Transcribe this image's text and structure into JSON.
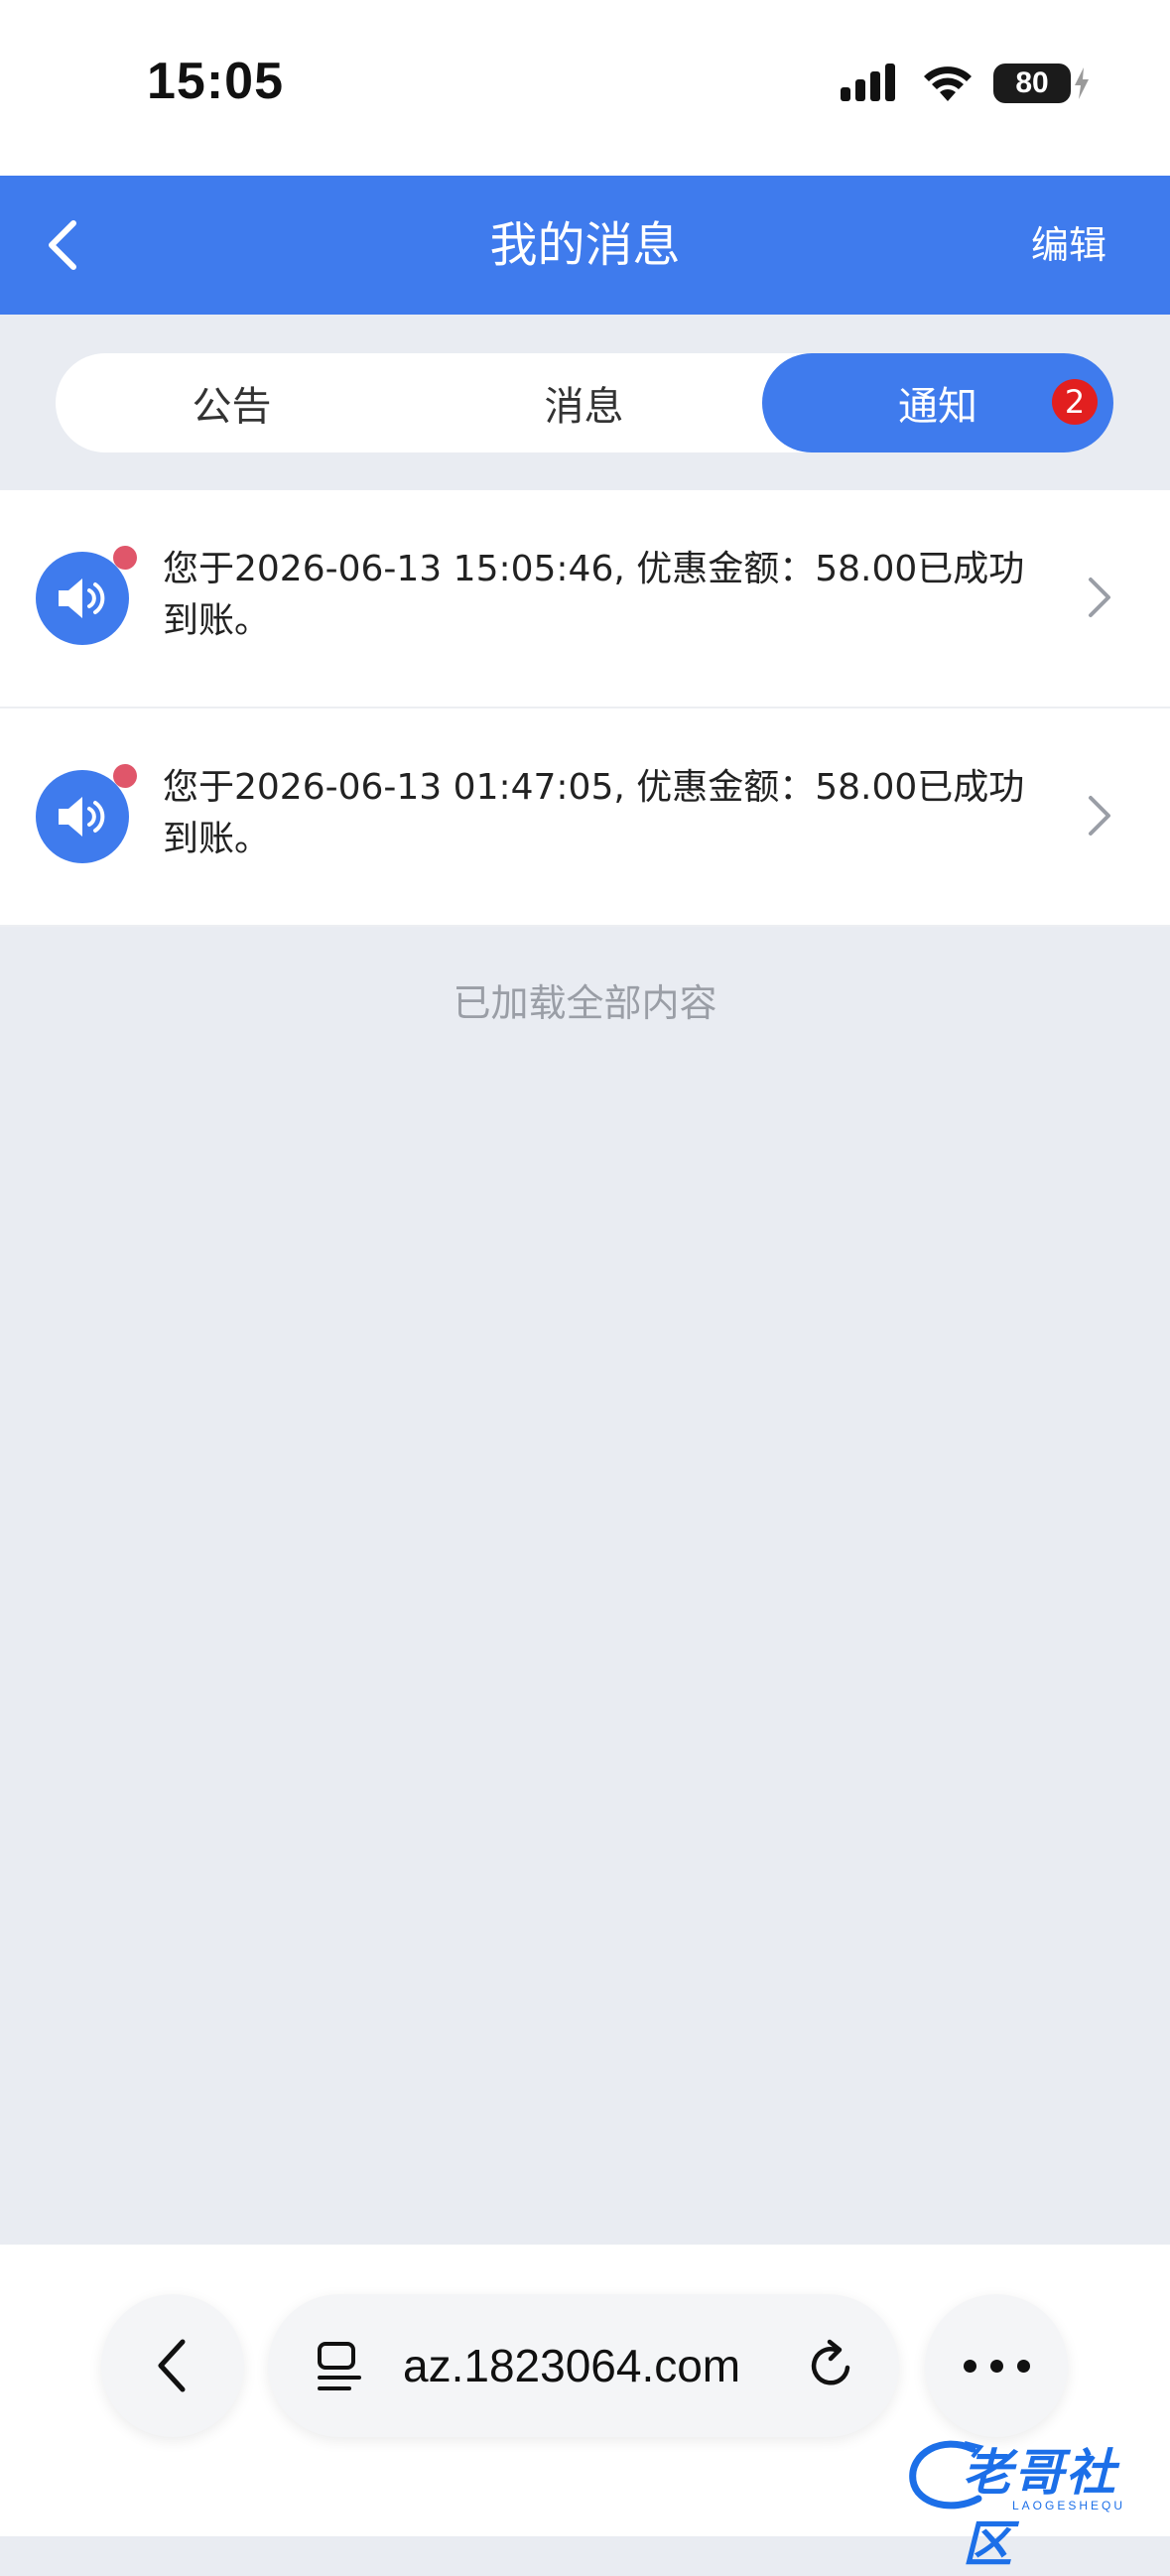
{
  "status_bar": {
    "time": "15:05",
    "battery": "80"
  },
  "header": {
    "title": "我的消息",
    "edit_label": "编辑"
  },
  "tabs": [
    {
      "label": "公告",
      "active": false
    },
    {
      "label": "消息",
      "active": false
    },
    {
      "label": "通知",
      "active": true,
      "badge": "2"
    }
  ],
  "notices": [
    {
      "text": "您于2026-06-13 15:05:46, 优惠金额：58.00已成功到账。",
      "unread": true,
      "icon": "speaker-icon"
    },
    {
      "text": "您于2026-06-13 01:47:05, 优惠金额：58.00已成功到账。",
      "unread": true,
      "icon": "speaker-icon"
    }
  ],
  "list_footer": "已加载全部内容",
  "browser": {
    "url": "az.1823064.com"
  },
  "watermark": {
    "text": "老哥社区",
    "sub": "LAOGESHEQU"
  },
  "colors": {
    "accent": "#3f7bed",
    "badge": "#e21f1f",
    "unread_dot": "#e0566a",
    "background": "#e9ecf2"
  }
}
